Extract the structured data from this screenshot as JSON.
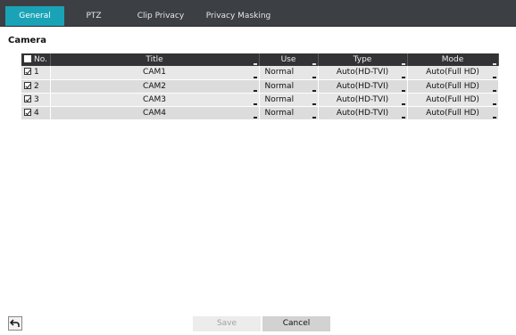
{
  "tabs": [
    {
      "label": "General",
      "active": true
    },
    {
      "label": "PTZ",
      "active": false
    },
    {
      "label": "Clip Privacy",
      "active": false
    },
    {
      "label": "Privacy Masking",
      "active": false
    }
  ],
  "section_title": "Camera",
  "table": {
    "headers": {
      "no": "No.",
      "title": "Title",
      "use": "Use",
      "type": "Type",
      "mode": "Mode"
    },
    "rows": [
      {
        "no": "1",
        "title": "CAM1",
        "use": "Normal",
        "type": "Auto(HD-TVI)",
        "mode": "Auto(Full HD)",
        "checked": true
      },
      {
        "no": "2",
        "title": "CAM2",
        "use": "Normal",
        "type": "Auto(HD-TVI)",
        "mode": "Auto(Full HD)",
        "checked": true
      },
      {
        "no": "3",
        "title": "CAM3",
        "use": "Normal",
        "type": "Auto(HD-TVI)",
        "mode": "Auto(Full HD)",
        "checked": true
      },
      {
        "no": "4",
        "title": "CAM4",
        "use": "Normal",
        "type": "Auto(HD-TVI)",
        "mode": "Auto(Full HD)",
        "checked": true
      }
    ]
  },
  "buttons": {
    "save": "Save",
    "cancel": "Cancel"
  },
  "colors": {
    "accent": "#1aa3b6",
    "tabbar": "#3c3f44",
    "header": "#333336"
  }
}
